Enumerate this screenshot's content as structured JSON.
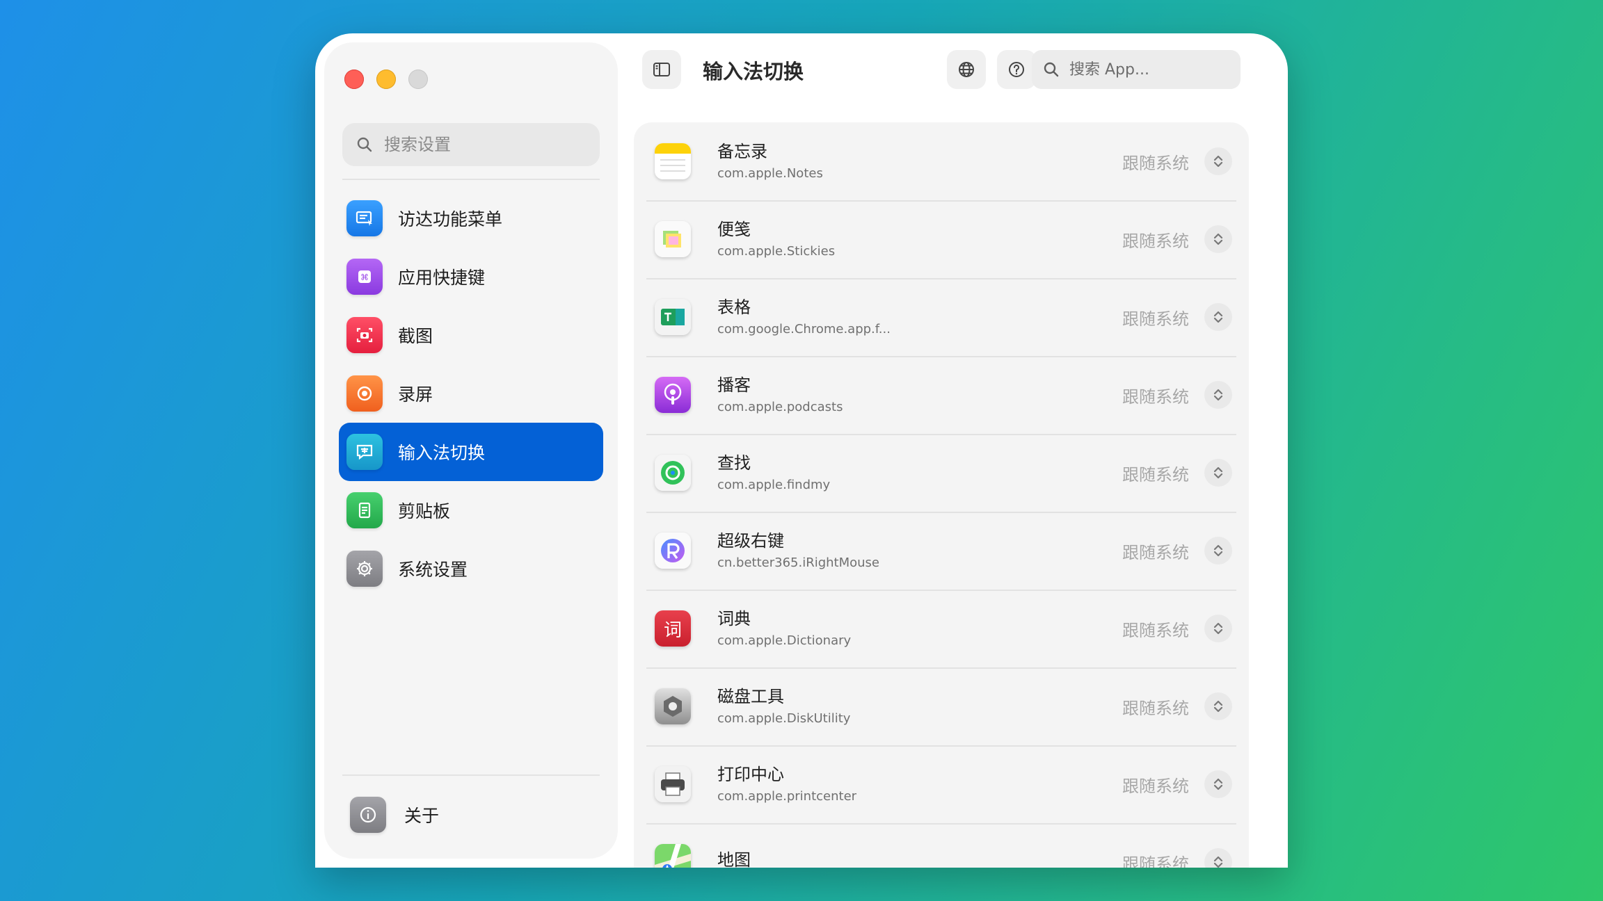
{
  "sidebar": {
    "search_placeholder": "搜索设置",
    "items": [
      {
        "label": "访达功能菜单",
        "icon": "finder-menu-icon",
        "color": "#1f8ef5"
      },
      {
        "label": "应用快捷键",
        "icon": "command-key-icon",
        "color": "#9b4ae8"
      },
      {
        "label": "截图",
        "icon": "screenshot-icon",
        "color": "#f2314f"
      },
      {
        "label": "录屏",
        "icon": "record-icon",
        "color": "#f7762c"
      },
      {
        "label": "输入法切换",
        "icon": "input-method-icon",
        "color": "#1aa6d9"
      },
      {
        "label": "剪贴板",
        "icon": "clipboard-icon",
        "color": "#2fb85a"
      },
      {
        "label": "系统设置",
        "icon": "gear-icon",
        "color": "#8e8e93"
      }
    ],
    "active_index": 4,
    "about_label": "关于"
  },
  "header": {
    "title": "输入法切换",
    "search_placeholder": "搜索 App..."
  },
  "apps": [
    {
      "name": "备忘录",
      "bundle": "com.apple.Notes",
      "mode": "跟随系统",
      "icon": "notes-icon"
    },
    {
      "name": "便笺",
      "bundle": "com.apple.Stickies",
      "mode": "跟随系统",
      "icon": "stickies-icon"
    },
    {
      "name": "表格",
      "bundle": "com.google.Chrome.app.f...",
      "mode": "跟随系统",
      "icon": "sheets-icon"
    },
    {
      "name": "播客",
      "bundle": "com.apple.podcasts",
      "mode": "跟随系统",
      "icon": "podcasts-icon"
    },
    {
      "name": "查找",
      "bundle": "com.apple.findmy",
      "mode": "跟随系统",
      "icon": "findmy-icon"
    },
    {
      "name": "超级右键",
      "bundle": "cn.better365.iRightMouse",
      "mode": "跟随系统",
      "icon": "irightmouse-icon"
    },
    {
      "name": "词典",
      "bundle": "com.apple.Dictionary",
      "mode": "跟随系统",
      "icon": "dictionary-icon"
    },
    {
      "name": "磁盘工具",
      "bundle": "com.apple.DiskUtility",
      "mode": "跟随系统",
      "icon": "disk-utility-icon"
    },
    {
      "name": "打印中心",
      "bundle": "com.apple.printcenter",
      "mode": "跟随系统",
      "icon": "printer-icon"
    },
    {
      "name": "地图",
      "bundle": "",
      "mode": "跟随系统",
      "icon": "maps-icon"
    }
  ],
  "dictionary_glyph": "词",
  "accent_color": "#0461d6"
}
